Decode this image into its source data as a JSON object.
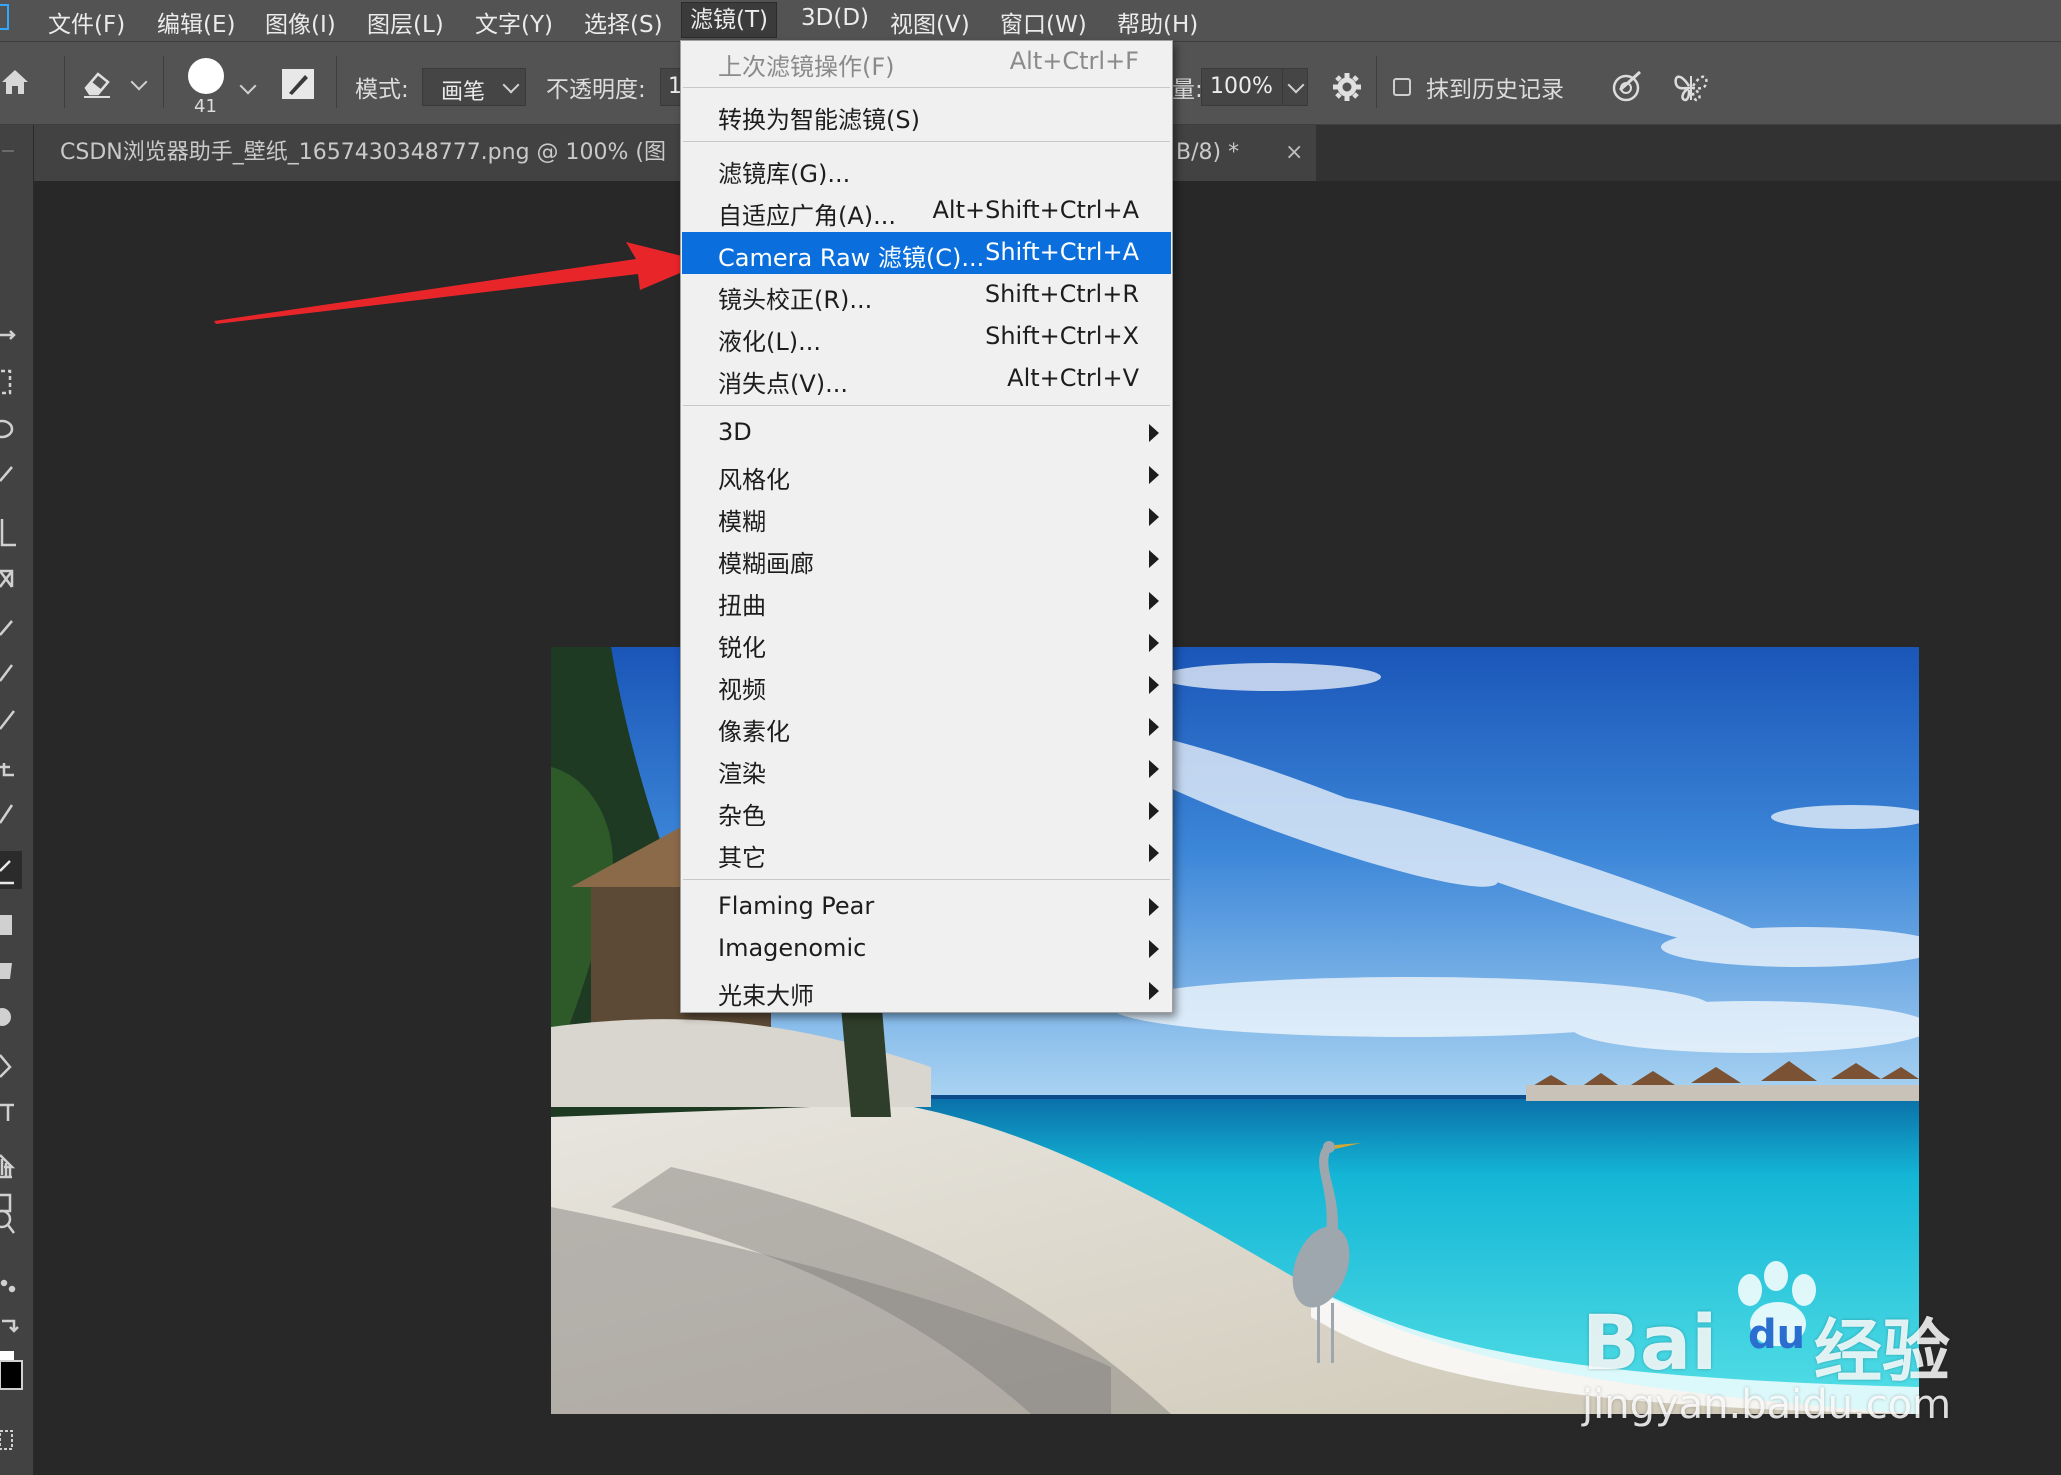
{
  "menubar": {
    "items": [
      {
        "label": "文件(F)"
      },
      {
        "label": "编辑(E)"
      },
      {
        "label": "图像(I)"
      },
      {
        "label": "图层(L)"
      },
      {
        "label": "文字(Y)"
      },
      {
        "label": "选择(S)"
      },
      {
        "label": "滤镜(T)"
      },
      {
        "label": "3D(D)"
      },
      {
        "label": "视图(V)"
      },
      {
        "label": "窗口(W)"
      },
      {
        "label": "帮助(H)"
      }
    ],
    "active_item": "滤镜(T)"
  },
  "options": {
    "brush_size": "41",
    "mode_label": "模式:",
    "mode_value": "画笔",
    "opacity_label": "不透明度:",
    "opacity_value_partial": "1",
    "flow_label_partial": "量:",
    "flow_value": "100%",
    "history_label": "抹到历史记录",
    "history_checked": false
  },
  "document": {
    "tab_title": "CSDN浏览器助手_壁纸_1657430348777.png @ 100% (图",
    "tab_suffix": "B/8) *",
    "close_glyph": "×"
  },
  "filter_menu": {
    "items": [
      {
        "label": "上次滤镜操作(F)",
        "shortcut": "Alt+Ctrl+F",
        "disabled": true
      },
      {
        "label": "转换为智能滤镜(S)",
        "shortcut": ""
      },
      {
        "label": "滤镜库(G)...",
        "shortcut": ""
      },
      {
        "label": "自适应广角(A)...",
        "shortcut": "Alt+Shift+Ctrl+A"
      },
      {
        "label": "Camera Raw 滤镜(C)...",
        "shortcut": "Shift+Ctrl+A",
        "highlighted": true
      },
      {
        "label": "镜头校正(R)...",
        "shortcut": "Shift+Ctrl+R"
      },
      {
        "label": "液化(L)...",
        "shortcut": "Shift+Ctrl+X"
      },
      {
        "label": "消失点(V)...",
        "shortcut": "Alt+Ctrl+V"
      },
      {
        "label": "3D",
        "submenu": true
      },
      {
        "label": "风格化",
        "submenu": true
      },
      {
        "label": "模糊",
        "submenu": true
      },
      {
        "label": "模糊画廊",
        "submenu": true
      },
      {
        "label": "扭曲",
        "submenu": true
      },
      {
        "label": "锐化",
        "submenu": true
      },
      {
        "label": "视频",
        "submenu": true
      },
      {
        "label": "像素化",
        "submenu": true
      },
      {
        "label": "渲染",
        "submenu": true
      },
      {
        "label": "杂色",
        "submenu": true
      },
      {
        "label": "其它",
        "submenu": true
      },
      {
        "label": "Flaming Pear",
        "submenu": true
      },
      {
        "label": "Imagenomic",
        "submenu": true
      },
      {
        "label": "光束大师",
        "submenu": true
      }
    ]
  },
  "watermark": {
    "brand_left": "Bai",
    "brand_mid": "du",
    "brand_right": "经验",
    "url": "jingyan.baidu.com"
  },
  "colors": {
    "menu_highlight": "#0a6fdc",
    "annotation_arrow": "#e8262a",
    "ps_accent": "#31a8ff"
  }
}
